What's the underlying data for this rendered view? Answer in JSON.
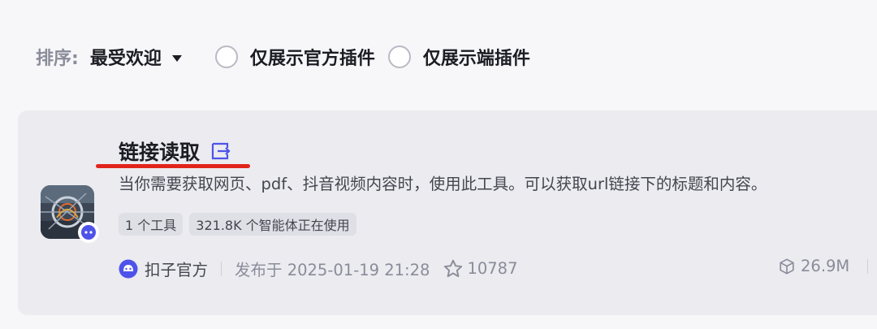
{
  "filters": {
    "sort_label": "排序:",
    "sort_value": "最受欢迎",
    "official_only_label": "仅展示官方插件",
    "client_only_label": "仅展示端插件"
  },
  "plugin": {
    "title": "链接读取",
    "description": "当你需要获取网页、pdf、抖音视频内容时，使用此工具。可以获取url链接下的标题和内容。",
    "tags": [
      "1 个工具",
      "321.8K 个智能体正在使用"
    ],
    "author": "扣子官方",
    "published": "发布于 2025-01-19 21:28",
    "stars": "10787",
    "usage_count": "26.9M"
  },
  "colors": {
    "accent": "#4d53e8",
    "underline": "#e1241b",
    "card_bg": "#ebebf0",
    "page_bg": "#f7f7fa"
  },
  "icons": [
    "caret-down-icon",
    "open-link-icon",
    "coze-official-icon",
    "star-icon",
    "cube-icon"
  ]
}
